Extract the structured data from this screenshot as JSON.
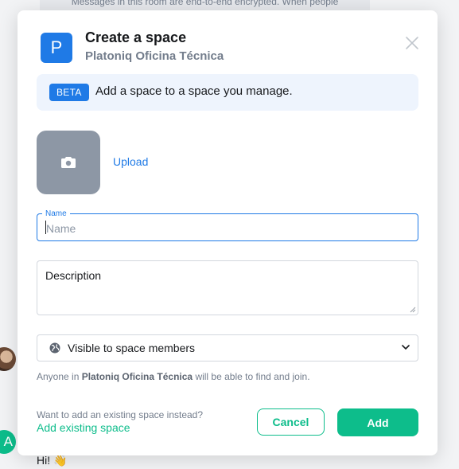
{
  "background": {
    "banner_text": "Messages in this room are end-to-end encrypted. When people",
    "avatar_letter": "A",
    "message": "Hi!",
    "message_emoji": "👋"
  },
  "dialog": {
    "avatar_letter": "P",
    "title": "Create a space",
    "subtitle": "Platoniq Oficina Técnica",
    "close_icon": "close-icon",
    "beta_badge": "BETA",
    "beta_text": "Add a space to a space you manage.",
    "upload_label": "Upload",
    "name_label": "Name",
    "name_placeholder": "Name",
    "name_value": "",
    "description_placeholder": "Description",
    "visibility": {
      "icon": "globe-icon",
      "selected": "Visible to space members"
    },
    "hint_prefix": "Anyone in",
    "hint_space": "Platoniq Oficina Técnica",
    "hint_suffix": "will be able to find and join.",
    "existing_question": "Want to add an existing space instead?",
    "existing_link": "Add existing space",
    "cancel_label": "Cancel",
    "add_label": "Add"
  },
  "colors": {
    "accent_blue": "#1f7ae6",
    "accent_green": "#0dbd8b",
    "muted_text": "#737d8c",
    "tile_gray": "#8d97a5"
  }
}
